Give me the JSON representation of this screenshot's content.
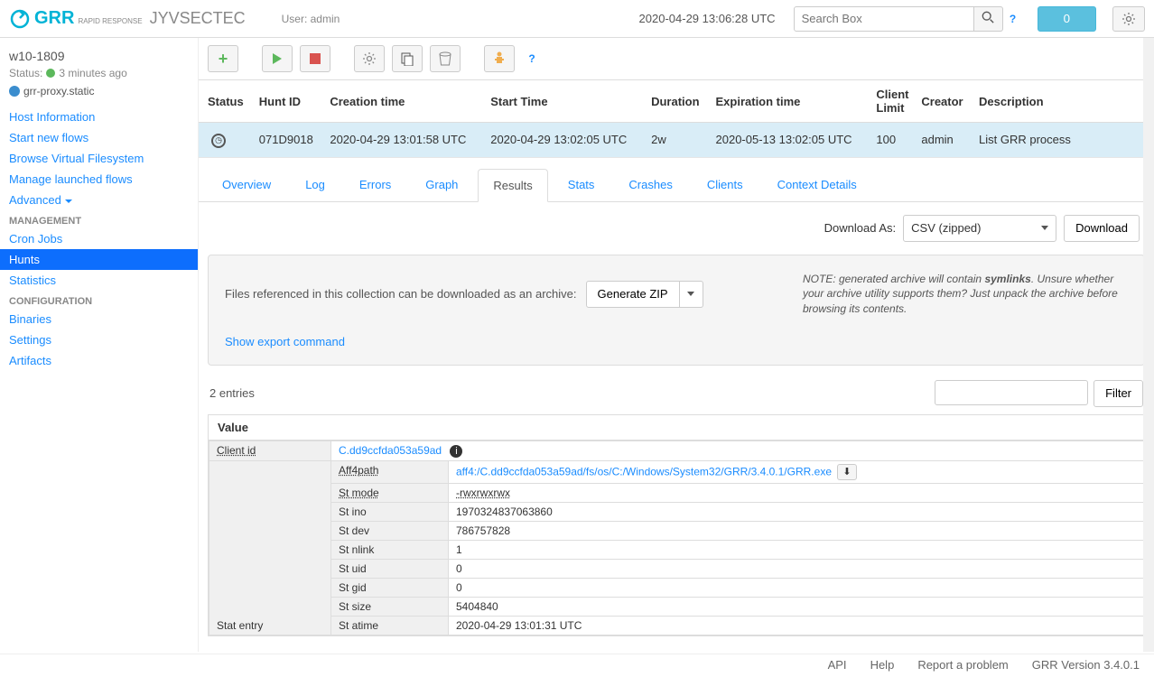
{
  "header": {
    "logo_text": "GRR",
    "logo_sub": "RAPID RESPONSE",
    "brand_sub": "JYVSECTEC",
    "user_label": "User: admin",
    "timestamp": "2020-04-29 13:06:28 UTC",
    "search_placeholder": "Search Box",
    "notif_count": "0"
  },
  "client": {
    "name": "w10-1809",
    "status_prefix": "Status:",
    "status_text": "3 minutes ago",
    "ip": "grr-proxy.static"
  },
  "nav": {
    "host_info": "Host Information",
    "start_flows": "Start new flows",
    "browse_vfs": "Browse Virtual Filesystem",
    "manage_flows": "Manage launched flows",
    "advanced": "Advanced",
    "management": "MANAGEMENT",
    "cron": "Cron Jobs",
    "hunts": "Hunts",
    "stats": "Statistics",
    "configuration": "CONFIGURATION",
    "binaries": "Binaries",
    "settings": "Settings",
    "artifacts": "Artifacts"
  },
  "hunts_table": {
    "headers": [
      "Status",
      "Hunt ID",
      "Creation time",
      "Start Time",
      "Duration",
      "Expiration time",
      "Client Limit",
      "Creator",
      "Description"
    ],
    "row": {
      "hunt_id": "071D9018",
      "creation": "2020-04-29 13:01:58 UTC",
      "start": "2020-04-29 13:02:05 UTC",
      "duration": "2w",
      "expiration": "2020-05-13 13:02:05 UTC",
      "limit": "100",
      "creator": "admin",
      "description": "List GRR process"
    }
  },
  "tabs": {
    "overview": "Overview",
    "log": "Log",
    "errors": "Errors",
    "graph": "Graph",
    "results": "Results",
    "stats": "Stats",
    "crashes": "Crashes",
    "clients": "Clients",
    "context": "Context Details"
  },
  "download": {
    "label": "Download As:",
    "format": "CSV (zipped)",
    "button": "Download"
  },
  "archive": {
    "text": "Files referenced in this collection can be downloaded as an archive:",
    "button": "Generate ZIP",
    "note_pre": "NOTE: generated archive will contain ",
    "note_bold": "symlinks",
    "note_post": ". Unsure whether your archive utility supports them? Just unpack the archive before browsing its contents.",
    "export_link": "Show export command"
  },
  "results": {
    "count": "2 entries",
    "filter": "Filter",
    "value_header": "Value",
    "client_id_label": "Client id",
    "client_id": "C.dd9ccfda053a59ad",
    "stat_entry_label": "Stat entry",
    "fields": {
      "aff4path_label": "Aff4path",
      "aff4path": "aff4:/C.dd9ccfda053a59ad/fs/os/C:/Windows/System32/GRR/3.4.0.1/GRR.exe",
      "st_mode_label": "St mode",
      "st_mode": "-rwxrwxrwx",
      "st_ino_label": "St ino",
      "st_ino": "1970324837063860",
      "st_dev_label": "St dev",
      "st_dev": "786757828",
      "st_nlink_label": "St nlink",
      "st_nlink": "1",
      "st_uid_label": "St uid",
      "st_uid": "0",
      "st_gid_label": "St gid",
      "st_gid": "0",
      "st_size_label": "St size",
      "st_size": "5404840",
      "st_atime_label": "St atime",
      "st_atime": "2020-04-29 13:01:31 UTC"
    }
  },
  "footer": {
    "api": "API",
    "help": "Help",
    "report": "Report a problem",
    "version": "GRR Version 3.4.0.1"
  }
}
